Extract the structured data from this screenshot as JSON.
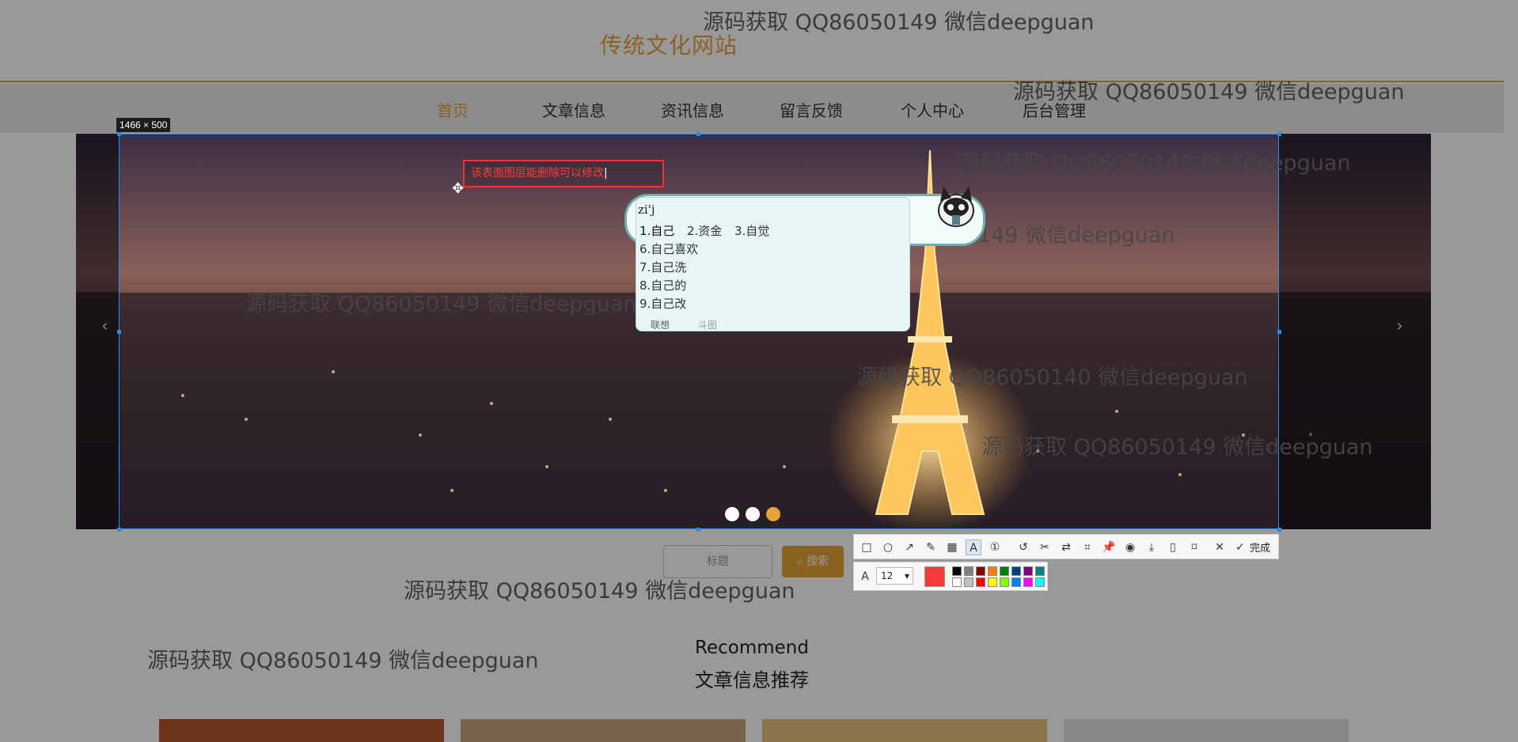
{
  "site": {
    "title": "传统文化网站",
    "nav": [
      "首页",
      "文章信息",
      "资讯信息",
      "留言反馈",
      "个人中心",
      "后台管理"
    ],
    "active_nav": "首页",
    "prev_arrow": "‹",
    "next_arrow": "›"
  },
  "search": {
    "placeholder": "标题",
    "button_label": "搜索"
  },
  "recommend": {
    "title": "Recommend",
    "subtitle": "文章信息推荐"
  },
  "watermark_text": "源码获取 QQ86050149 微信deepguan",
  "watermark_text_alt": "源码获取 QQ86050140 微信deepguan",
  "screenshot_tool": {
    "size_label": "1466 × 500",
    "text_annotation": "该表面图层能删除可以修改",
    "ime": {
      "pinyin": "zi'j",
      "candidates_row": [
        "1.自己",
        "2.资金",
        "3.自觉"
      ],
      "candidates_list": [
        "6.自己喜欢",
        "7.自己洗",
        "8.自己的",
        "9.自己改"
      ],
      "bottom_tabs": [
        "联想",
        "斗图"
      ]
    },
    "toolbar": {
      "done_label": "完成",
      "font_size": "12",
      "current_color": "#f23a3a",
      "palette": [
        "#000000",
        "#808080",
        "#800000",
        "#ff8000",
        "#008000",
        "#004080",
        "#800080",
        "#008080",
        "#ffffff",
        "#c0c0c0",
        "#ff0000",
        "#ffff00",
        "#80ff00",
        "#0080ff",
        "#ff00ff",
        "#00ffff"
      ],
      "icons": [
        "rect-icon",
        "ellipse-icon",
        "arrow-icon",
        "pen-icon",
        "mosaic-icon",
        "text-icon",
        "number-icon",
        "undo-icon",
        "cut-icon",
        "translate-icon",
        "ocr-icon",
        "pin-icon",
        "record-icon",
        "save-icon",
        "save-phone-icon",
        "bookmark-icon",
        "close-icon"
      ]
    }
  },
  "colors": {
    "accent": "#e8a23a",
    "selection": "#2b8be8",
    "annotation": "#ff3b3b"
  }
}
